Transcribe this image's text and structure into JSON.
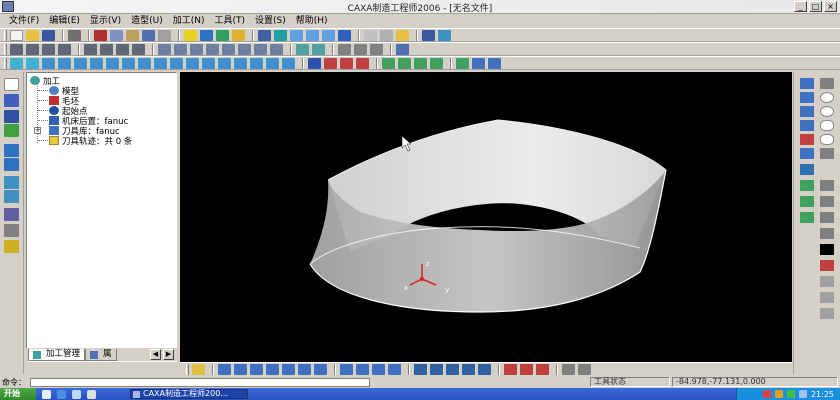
{
  "window": {
    "title": "CAXA制造工程师2006 - [无名文件]",
    "buttons": [
      "_",
      "□",
      "×"
    ]
  },
  "menu": {
    "items": [
      "文件(F)",
      "编辑(E)",
      "显示(V)",
      "造型(U)",
      "加工(N)",
      "工具(T)",
      "设置(S)",
      "帮助(H)"
    ]
  },
  "tree": {
    "root": "加工",
    "items": [
      "模型",
      "毛坯",
      "起始点",
      "机床后置：fanuc",
      "刀具库：fanuc",
      "刀具轨迹：共 0 条"
    ]
  },
  "tree_tabs": {
    "tab1": "加工管理",
    "tab2": "属"
  },
  "viewport": {
    "axis_labels": {
      "x": "x",
      "y": "y",
      "z": "z"
    },
    "background": "#000000",
    "surface_color": "#d8d8d8"
  },
  "status": {
    "command_label": "命令：",
    "tool_status": "工具状态",
    "coordinates": "-84.978,-77.131,0.000"
  },
  "taskbar": {
    "start": "开始",
    "task": "CAXA制造工程师200...",
    "clock": "21:25"
  },
  "colors": {
    "accent": "#2a52c0",
    "chrome": "#d4d0c8",
    "tree_folder": "#e8c840"
  }
}
